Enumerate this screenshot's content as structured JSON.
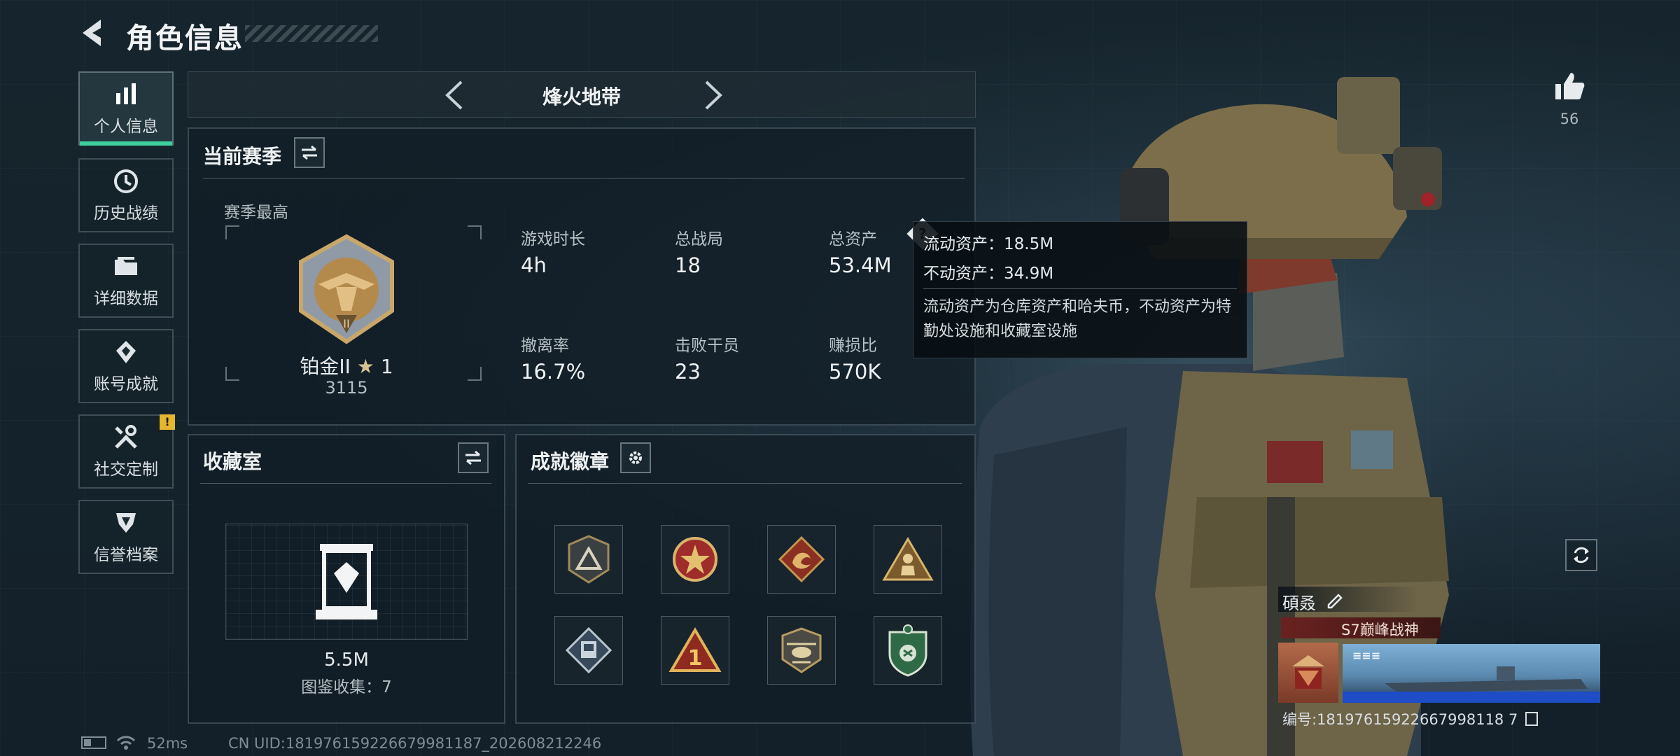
{
  "header": {
    "title": "角色信息",
    "back_icon": "back-arrow-icon"
  },
  "sidebar": {
    "items": [
      {
        "label": "个人信息",
        "icon": "bar-chart-icon",
        "active": true
      },
      {
        "label": "历史战绩",
        "icon": "history-clock-icon",
        "active": false
      },
      {
        "label": "详细数据",
        "icon": "folder-icon",
        "active": false
      },
      {
        "label": "账号成就",
        "icon": "achievement-icon",
        "active": false
      },
      {
        "label": "社交定制",
        "icon": "tools-icon",
        "active": false,
        "alert": "!"
      },
      {
        "label": "信誉档案",
        "icon": "shield-emblem-icon",
        "active": false
      }
    ]
  },
  "mode": {
    "name": "烽火地带"
  },
  "season": {
    "title": "当前赛季",
    "best_label": "赛季最高",
    "rank_name": "铂金II",
    "rank_stars": "1",
    "rank_points": "3115",
    "stats": [
      {
        "label": "游戏时长",
        "value": "4h"
      },
      {
        "label": "总战局",
        "value": "18"
      },
      {
        "label": "总资产",
        "value": "53.4M"
      },
      {
        "label": "撤离率",
        "value": "16.7%"
      },
      {
        "label": "击败干员",
        "value": "23"
      },
      {
        "label": "赚损比",
        "value": "570K"
      }
    ]
  },
  "tooltip": {
    "liquid": "流动资产：18.5M",
    "fixed": "不动资产：34.9M",
    "desc": "流动资产为仓库资产和哈夫币，不动资产为特勤处设施和收藏室设施"
  },
  "collection": {
    "title": "收藏室",
    "value": "5.5M",
    "count_text": "图鉴收集：7"
  },
  "achievements": {
    "title": "成就徽章",
    "badges": [
      "triangle-badge-icon",
      "star-wreath-badge-icon",
      "dragon-badge-icon",
      "soldier-triangle-badge-icon",
      "armor-diamond-badge-icon",
      "number-one-badge-icon",
      "helicopter-badge-icon",
      "green-shield-badge-icon"
    ]
  },
  "likes": {
    "count": "56"
  },
  "profile": {
    "name": "碩叒",
    "title_tag": "S7巅峰战神",
    "id_text": "编号:18197615922667998118 7"
  },
  "status_bar": {
    "ping": "52ms",
    "uid": "CN UID:181976159226679981187_202608212246"
  },
  "colors": {
    "accent": "#3fd0a0",
    "alert": "#e6b62e",
    "background": "#142129"
  }
}
